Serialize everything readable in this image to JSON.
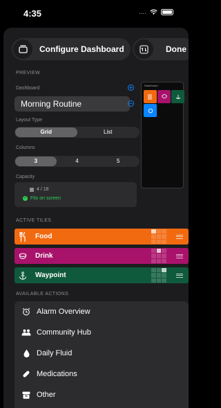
{
  "status_bar": {
    "time": "4:35",
    "signal": "...."
  },
  "header": {
    "title": "Configure Dashboard",
    "done_label": "Done"
  },
  "preview_section": {
    "label": "PREVIEW",
    "preview_title": "Dashboard"
  },
  "dashboard": {
    "label": "Dashboard",
    "value": "Morning Routine"
  },
  "layout_type": {
    "label": "Layout Type",
    "options": [
      "Grid",
      "List"
    ],
    "selected": "Grid"
  },
  "columns": {
    "label": "Columns",
    "options": [
      "3",
      "4",
      "5"
    ],
    "selected": "3"
  },
  "capacity": {
    "label": "Capacity",
    "value": "4 / 18",
    "status": "Fits on screen"
  },
  "active_tiles": {
    "label": "ACTIVE TILES",
    "items": [
      {
        "name": "Food",
        "color": "#f26a10",
        "icon": "fork-knife-icon"
      },
      {
        "name": "Drink",
        "color": "#a8126a",
        "icon": "cup-icon"
      },
      {
        "name": "Waypoint",
        "color": "#0f5a3c",
        "icon": "anchor-icon"
      }
    ]
  },
  "available_actions": {
    "label": "AVAILABLE ACTIONS",
    "items": [
      {
        "label": "Alarm Overview",
        "icon": "alarm-clock-icon"
      },
      {
        "label": "Community Hub",
        "icon": "people-icon"
      },
      {
        "label": "Daily Fluid",
        "icon": "drop-icon"
      },
      {
        "label": "Medications",
        "icon": "pill-icon"
      },
      {
        "label": "Other",
        "icon": "archive-box-icon"
      }
    ]
  },
  "colors": {
    "accent": "#0a84ff",
    "success": "#30d158",
    "background": "#1c1c1e"
  }
}
